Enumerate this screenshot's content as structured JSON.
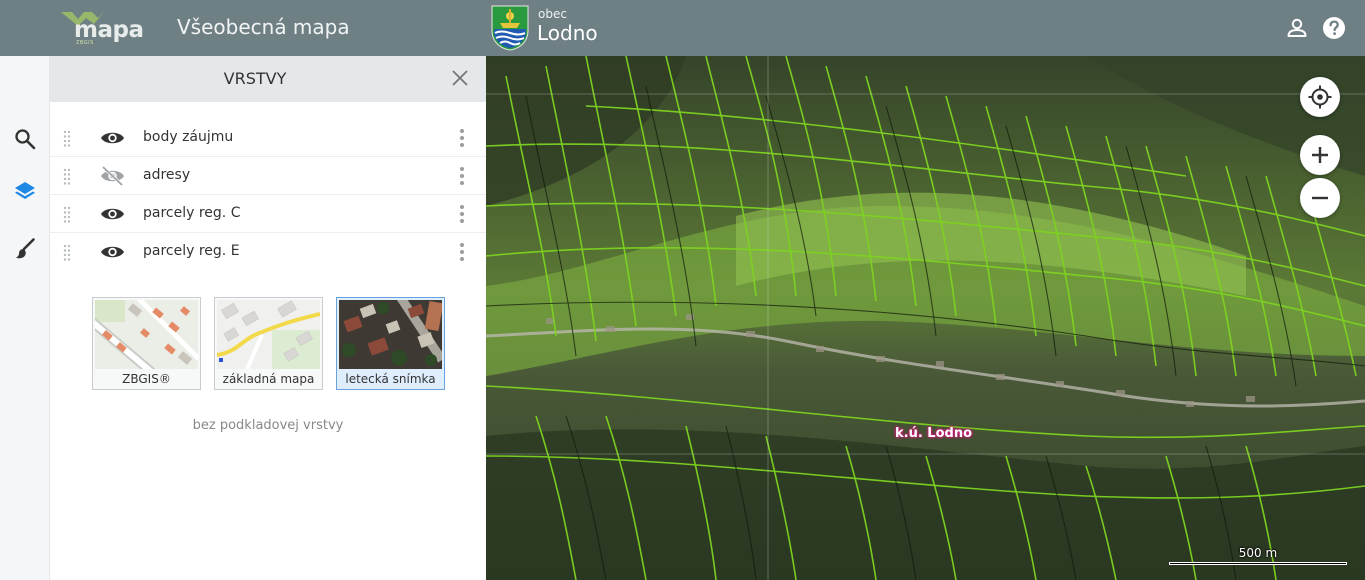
{
  "header": {
    "logo_text": "mapa",
    "logo_sub": "ZBGIS",
    "app_title": "Všeobecná mapa",
    "municipality_type": "obec",
    "municipality_name": "Lodno",
    "user_icon": "user-icon",
    "help_icon": "help-icon"
  },
  "nav": {
    "items": [
      {
        "icon": "search-icon"
      },
      {
        "icon": "layers-icon",
        "active": true
      },
      {
        "icon": "brush-icon"
      }
    ],
    "active_color": "#1e88e5"
  },
  "panel": {
    "title": "VRSTVY",
    "close_icon": "close-icon",
    "layers": [
      {
        "label": "body záujmu",
        "visible": true
      },
      {
        "label": "adresy",
        "visible": false
      },
      {
        "label": "parcely reg. C",
        "visible": true
      },
      {
        "label": "parcely reg. E",
        "visible": true
      }
    ],
    "basemaps": [
      {
        "label": "ZBGIS®",
        "active": false
      },
      {
        "label": "základná mapa",
        "active": false
      },
      {
        "label": "letecká snímka",
        "active": true
      }
    ],
    "no_basemap": "bez podkladovej vrstvy"
  },
  "map": {
    "cadastral_label": "k.ú. Lodno",
    "scale_label": "500 m",
    "controls": [
      "locate-icon",
      "zoom-in-icon",
      "zoom-out-icon"
    ],
    "parcel_color": "#7ed321"
  }
}
